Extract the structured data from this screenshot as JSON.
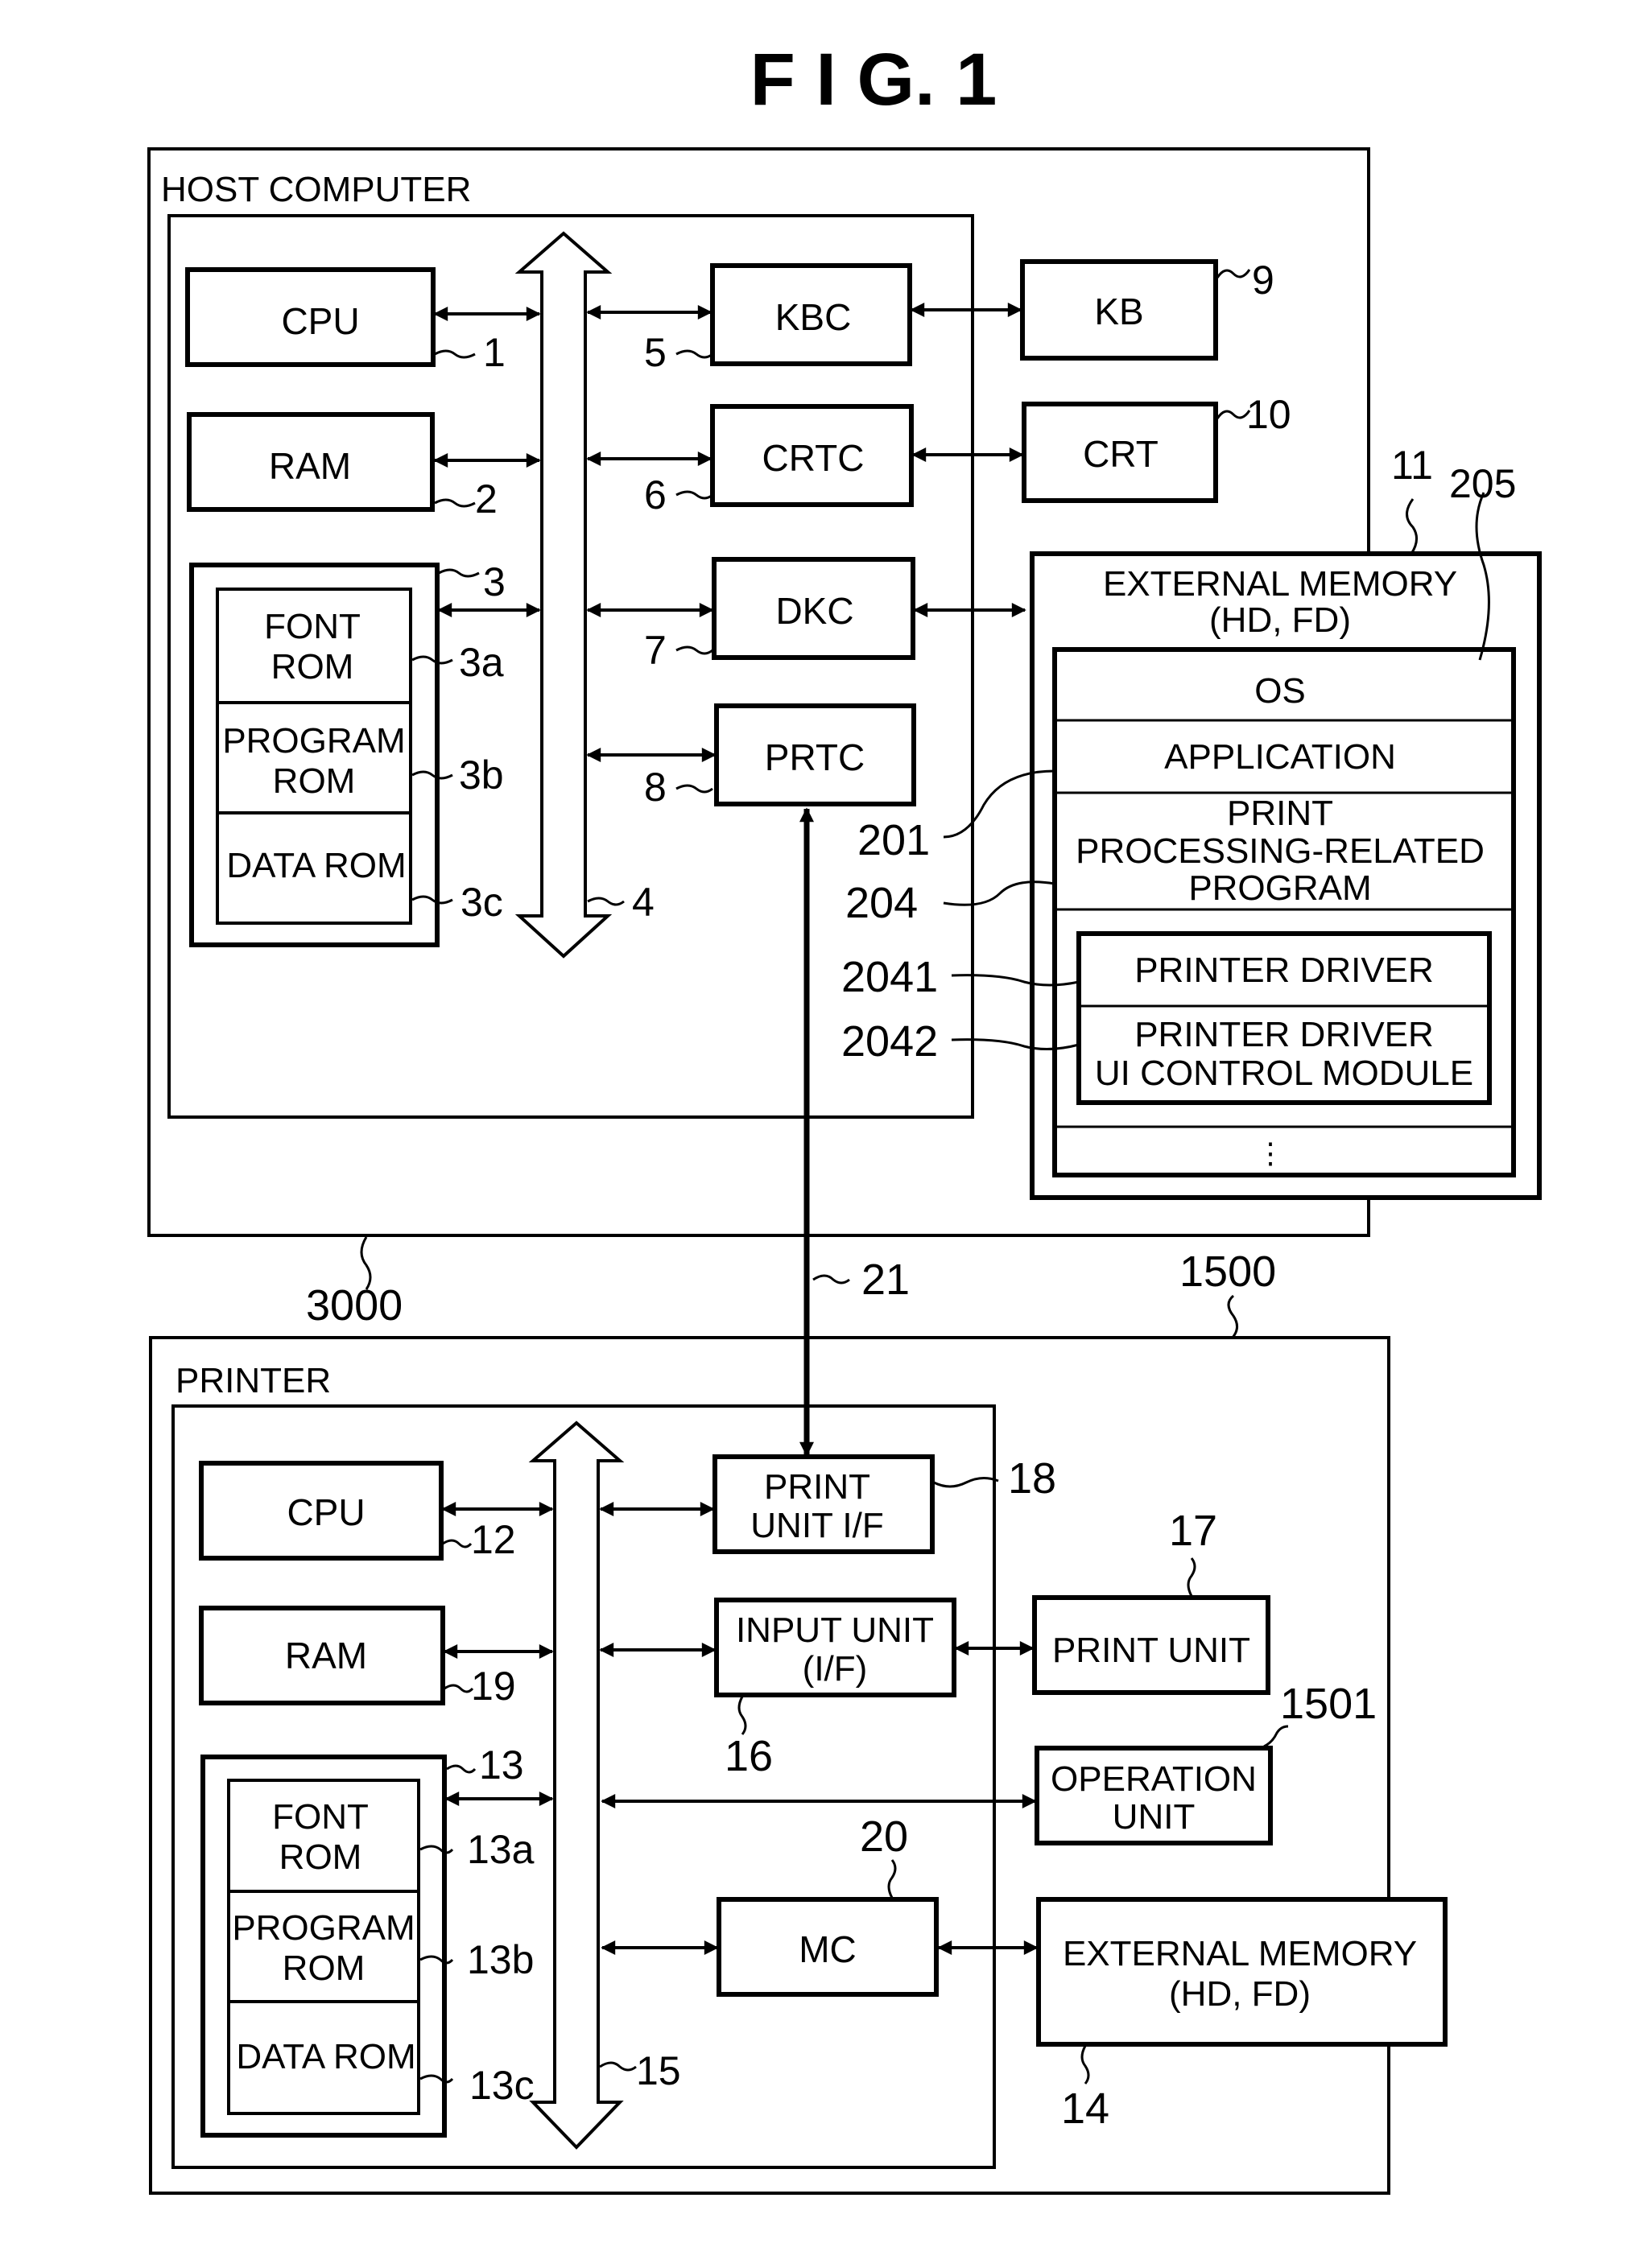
{
  "figure": {
    "title": "F I G.   1"
  },
  "host": {
    "label": "HOST COMPUTER",
    "ref": "3000",
    "cpu": {
      "label": "CPU",
      "ref": "1"
    },
    "ram": {
      "label": "RAM",
      "ref": "2"
    },
    "rom": {
      "ref": "3",
      "font": {
        "line1": "FONT",
        "line2": "ROM",
        "ref": "3a"
      },
      "program": {
        "line1": "PROGRAM",
        "line2": "ROM",
        "ref": "3b"
      },
      "data": {
        "label": "DATA ROM",
        "ref": "3c"
      }
    },
    "bus": {
      "ref": "4"
    },
    "kbc": {
      "label": "KBC",
      "ref": "5"
    },
    "crtc": {
      "label": "CRTC",
      "ref": "6"
    },
    "dkc": {
      "label": "DKC",
      "ref": "7"
    },
    "prtc": {
      "label": "PRTC",
      "ref": "8"
    },
    "kb": {
      "label": "KB",
      "ref": "9"
    },
    "crt": {
      "label": "CRT",
      "ref": "10"
    }
  },
  "external_memory_host": {
    "ref": "11",
    "inner_ref": "205",
    "line1": "EXTERNAL  MEMORY",
    "line2": "(HD,  FD)",
    "os": "OS",
    "application": {
      "label": "APPLICATION",
      "ref": "201"
    },
    "print_program": {
      "line1": "PRINT",
      "line2": "PROCESSING-RELATED",
      "line3": "PROGRAM",
      "ref": "204"
    },
    "printer_driver": {
      "label": "PRINTER  DRIVER",
      "ref": "2041"
    },
    "ui_module": {
      "line1": "PRINTER  DRIVER",
      "line2": "UI  CONTROL  MODULE",
      "ref": "2042"
    },
    "more": "⋮"
  },
  "connection": {
    "ref": "21"
  },
  "printer": {
    "label": "PRINTER",
    "ref": "1500",
    "cpu": {
      "label": "CPU",
      "ref": "12"
    },
    "ram": {
      "label": "RAM",
      "ref": "19"
    },
    "rom": {
      "ref": "13",
      "font": {
        "line1": "FONT",
        "line2": "ROM",
        "ref": "13a"
      },
      "program": {
        "line1": "PROGRAM",
        "line2": "ROM",
        "ref": "13b"
      },
      "data": {
        "label": "DATA ROM",
        "ref": "13c"
      }
    },
    "bus": {
      "ref": "15"
    },
    "print_unit_if": {
      "line1": "PRINT",
      "line2": "UNIT  I/F",
      "ref": "18"
    },
    "input_unit": {
      "line1": "INPUT  UNIT",
      "line2": "(I/F)",
      "ref": "16"
    },
    "mc": {
      "label": "MC",
      "ref": "20"
    },
    "print_unit": {
      "label": "PRINT  UNIT",
      "ref": "17"
    },
    "operation_unit": {
      "line1": "OPERATION",
      "line2": "UNIT",
      "ref": "1501"
    },
    "external_memory": {
      "line1": "EXTERNAL  MEMORY",
      "line2": "(HD,  FD)",
      "ref": "14"
    }
  }
}
